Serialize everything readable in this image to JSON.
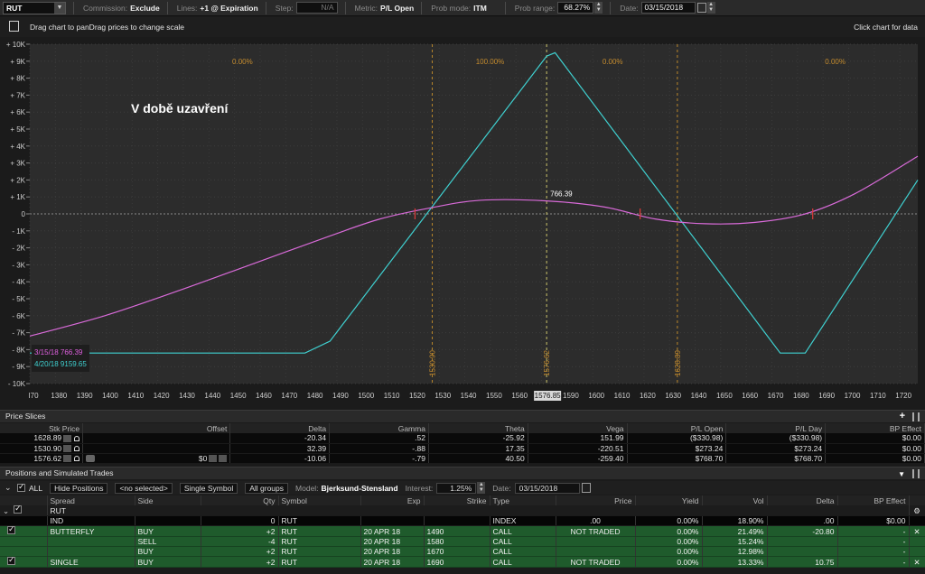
{
  "toolbar": {
    "symbol": "RUT",
    "commission_label": "Commission:",
    "commission_value": "Exclude",
    "lines_label": "Lines:",
    "lines_value": "+1 @ Expiration",
    "step_label": "Step:",
    "step_value": "N/A",
    "metric_label": "Metric:",
    "metric_value": "P/L Open",
    "prob_mode_label": "Prob mode:",
    "prob_mode_value": "ITM",
    "prob_range_label": "Prob range:",
    "prob_range_value": "68.27%",
    "date_label": "Date:",
    "date_value": "03/15/2018"
  },
  "chart_header": {
    "hint": "Drag chart to panDrag prices to change scale",
    "hint_right": "Click chart for data"
  },
  "chart_data": {
    "type": "line",
    "annotation": "V době uzavření",
    "x_ticks": [
      "I70",
      "1380",
      "1390",
      "1400",
      "1410",
      "1420",
      "1430",
      "1440",
      "1450",
      "1460",
      "1470",
      "1480",
      "1490",
      "1500",
      "1510",
      "1520",
      "1530",
      "1540",
      "1550",
      "1560",
      "157",
      "1590",
      "1600",
      "1610",
      "1620",
      "1630",
      "1640",
      "1650",
      "1660",
      "1670",
      "1680",
      "1690",
      "1700",
      "1710",
      "1720"
    ],
    "y_ticks": [
      "10K",
      "9K",
      "8K",
      "7K",
      "6K",
      "5K",
      "4K",
      "3K",
      "2K",
      "1K",
      "0",
      "-1K",
      "-2K",
      "-3K",
      "-4K",
      "-5K",
      "-6K",
      "-7K",
      "-8K",
      "-9K",
      "-10K"
    ],
    "xlim": [
      1370,
      1725
    ],
    "ylim": [
      -10000,
      10000
    ],
    "current_price_label": "1576.85",
    "current_value_label": "766.39",
    "vertical_lines": [
      {
        "value": 1530.9,
        "label": "1530.90"
      },
      {
        "value": 1576.62,
        "label": "1576.62"
      },
      {
        "value": 1628.89,
        "label": "1628.89"
      }
    ],
    "probability_labels": [
      "0.00%",
      "100.00%",
      "0.00%",
      "0.00%"
    ],
    "legend": [
      {
        "label": "3/15/18",
        "value": "766.39",
        "color": "#e060e0"
      },
      {
        "label": "4/20/18",
        "value": "9159.65",
        "color": "#3fd0d0"
      }
    ],
    "series": [
      {
        "name": "4/20/18",
        "color": "#3fd0d0",
        "x": [
          1370,
          1480,
          1490,
          1576.6,
          1580,
          1670,
          1680,
          1725
        ],
        "y": [
          -8200,
          -8200,
          -7500,
          9300,
          9500,
          -8200,
          -8200,
          2000
        ]
      },
      {
        "name": "3/15/18",
        "color": "#d86ad8",
        "x": [
          1370,
          1400,
          1430,
          1460,
          1490,
          1510,
          1530,
          1550,
          1576.6,
          1600,
          1620,
          1640,
          1660,
          1680,
          1700,
          1725
        ],
        "y": [
          -7200,
          -6000,
          -4500,
          -2900,
          -1300,
          -300,
          350,
          800,
          766,
          400,
          -300,
          -580,
          -500,
          0,
          1200,
          3400
        ]
      }
    ]
  },
  "price_slices": {
    "title": "Price Slices",
    "columns": [
      "Stk Price",
      "Offset",
      "Delta",
      "Gamma",
      "Theta",
      "Vega",
      "P/L Open",
      "P/L Day",
      "BP Effect"
    ],
    "rows": [
      [
        "1628.89",
        "",
        "-20.34",
        ".52",
        "-25.92",
        "151.99",
        "($330.98)",
        "($330.98)",
        "$0.00"
      ],
      [
        "1530.90",
        "",
        "32.39",
        "-.88",
        "17.35",
        "-220.51",
        "$273.24",
        "$273.24",
        "$0.00"
      ],
      [
        "1576.62",
        "$0",
        "-10.06",
        "-.79",
        "40.50",
        "-259.40",
        "$768.70",
        "$768.70",
        "$0.00"
      ]
    ]
  },
  "positions": {
    "title": "Positions and Simulated Trades",
    "all_label": "ALL",
    "hide_positions": "Hide Positions",
    "no_selected": "<no selected>",
    "single_symbol": "Single Symbol",
    "all_groups": "All groups",
    "model_label": "Model:",
    "model_value": "Bjerksund-Stensland",
    "interest_label": "Interest:",
    "interest_value": "1.25%",
    "date_label": "Date:",
    "date_value": "03/15/2018",
    "columns": [
      "Spread",
      "Side",
      "Qty",
      "Symbol",
      "Exp",
      "Strike",
      "Type",
      "Price",
      "Yield",
      "Vol",
      "Delta",
      "BP Effect"
    ],
    "group": "RUT",
    "rows": [
      {
        "spread": "IND",
        "side": "",
        "qty": "0",
        "symbol": "RUT",
        "exp": "",
        "strike": "",
        "type": "INDEX",
        "price": ".00",
        "yield": "0.00%",
        "vol": "18.90%",
        "delta": ".00",
        "bp": "$0.00"
      },
      {
        "spread": "BUTTERFLY",
        "side": "BUY",
        "qty": "+2",
        "symbol": "RUT",
        "exp": "20 APR 18",
        "strike": "1490",
        "type": "CALL",
        "price": "NOT TRADED",
        "yield": "0.00%",
        "vol": "21.49%",
        "delta": "-20.80",
        "bp": "-"
      },
      {
        "spread": "",
        "side": "SELL",
        "qty": "-4",
        "symbol": "RUT",
        "exp": "20 APR 18",
        "strike": "1580",
        "type": "CALL",
        "price": "",
        "yield": "0.00%",
        "vol": "15.24%",
        "delta": "",
        "bp": "-"
      },
      {
        "spread": "",
        "side": "BUY",
        "qty": "+2",
        "symbol": "RUT",
        "exp": "20 APR 18",
        "strike": "1670",
        "type": "CALL",
        "price": "",
        "yield": "0.00%",
        "vol": "12.98%",
        "delta": "",
        "bp": "-"
      },
      {
        "spread": "SINGLE",
        "side": "BUY",
        "qty": "+2",
        "symbol": "RUT",
        "exp": "20 APR 18",
        "strike": "1690",
        "type": "CALL",
        "price": "NOT TRADED",
        "yield": "0.00%",
        "vol": "13.33%",
        "delta": "10.75",
        "bp": "-"
      }
    ]
  }
}
